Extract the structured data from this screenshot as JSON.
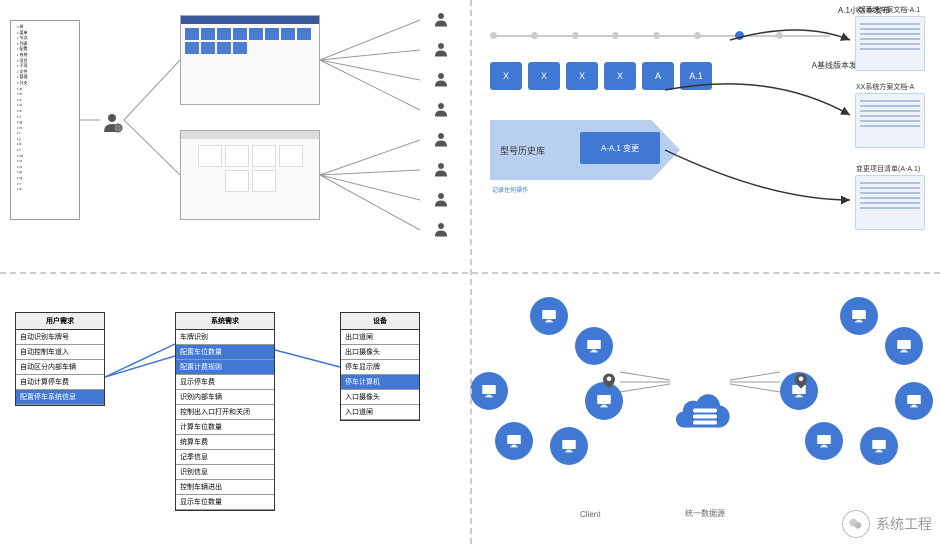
{
  "q1": {
    "tree_items": [
      "树",
      "菜单",
      "节点",
      "列表",
      "配置",
      "系统",
      "项目",
      "子项",
      "文件",
      "管理",
      "分支",
      "a",
      "b",
      "c",
      "d",
      "e",
      "f",
      "g",
      "h",
      "i",
      "j",
      "k",
      "l",
      "m",
      "n",
      "o",
      "p",
      "q",
      "r",
      "s"
    ]
  },
  "q2": {
    "title_minor": "A.1小版本发布",
    "doc1_label": "XX系统方案文档-A.1",
    "title_base": "A基线版本发布",
    "doc2_label": "XX系统方案文档-A",
    "doc3_label": "变更项目清单(A-A.1)",
    "versions": [
      "X",
      "X",
      "X",
      "X",
      "A",
      "A.1"
    ],
    "history": "型号历史库",
    "change": "A-A.1 变更",
    "record": "记录住何操作"
  },
  "q3": {
    "h1": "用户需求",
    "h2": "系统需求",
    "h3": "设备",
    "c1": [
      "自动识别车牌号",
      "自动控制车道入",
      "自动区分内部车辆",
      "自动计算停车费",
      "配置停车系统信息"
    ],
    "c2": [
      "车牌识别",
      "配置车位数量",
      "配置计费规则",
      "显示停车费",
      "识别内部车辆",
      "控制出入口打开和关闭",
      "计算车位数量",
      "统算车费",
      "记季信息",
      "识别信息",
      "控制车辆进出",
      "显示车位数量"
    ],
    "c3": [
      "出口道闸",
      "出口摄像头",
      "停车显示牌",
      "停车计算机",
      "入口摄像头",
      "入口道闸"
    ]
  },
  "q4": {
    "left_label": "Client",
    "center_label": "统一数据源"
  },
  "watermark": "系统工程"
}
